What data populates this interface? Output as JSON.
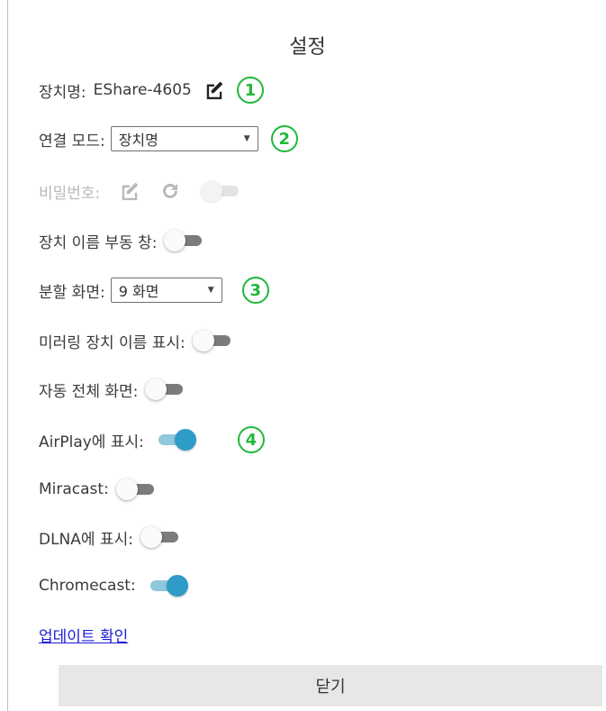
{
  "title": "설정",
  "device_name": {
    "label": "장치명:",
    "value": "EShare-4605",
    "edit_icon": "edit-icon",
    "badge": "1"
  },
  "connect_mode": {
    "label": "연결 모드:",
    "selected": "장치명",
    "badge": "2"
  },
  "password": {
    "label": "비밀번호:",
    "enabled": false,
    "edit_icon": "edit-icon",
    "refresh_icon": "refresh-icon"
  },
  "floating_window": {
    "label": "장치 이름 부동 창:",
    "on": false
  },
  "split_screen": {
    "label": "분할 화면:",
    "selected": "9 화면",
    "badge": "3"
  },
  "mirroring_name": {
    "label": "미러링 장치 이름 표시:",
    "on": false
  },
  "auto_fullscreen": {
    "label": "자동 전체 화면:",
    "on": false
  },
  "airplay": {
    "label": "AirPlay에 표시:",
    "on": true,
    "badge": "4"
  },
  "miracast": {
    "label": "Miracast:",
    "on": false
  },
  "dlna": {
    "label": "DLNA에 표시:",
    "on": false
  },
  "chromecast": {
    "label": "Chromecast:",
    "on": true
  },
  "update_link": "업데이트 확인",
  "close_button": "닫기",
  "colors": {
    "accent_green": "#1fb83a",
    "toggle_on": "#2f9bc7",
    "link": "#1b1bd8"
  }
}
